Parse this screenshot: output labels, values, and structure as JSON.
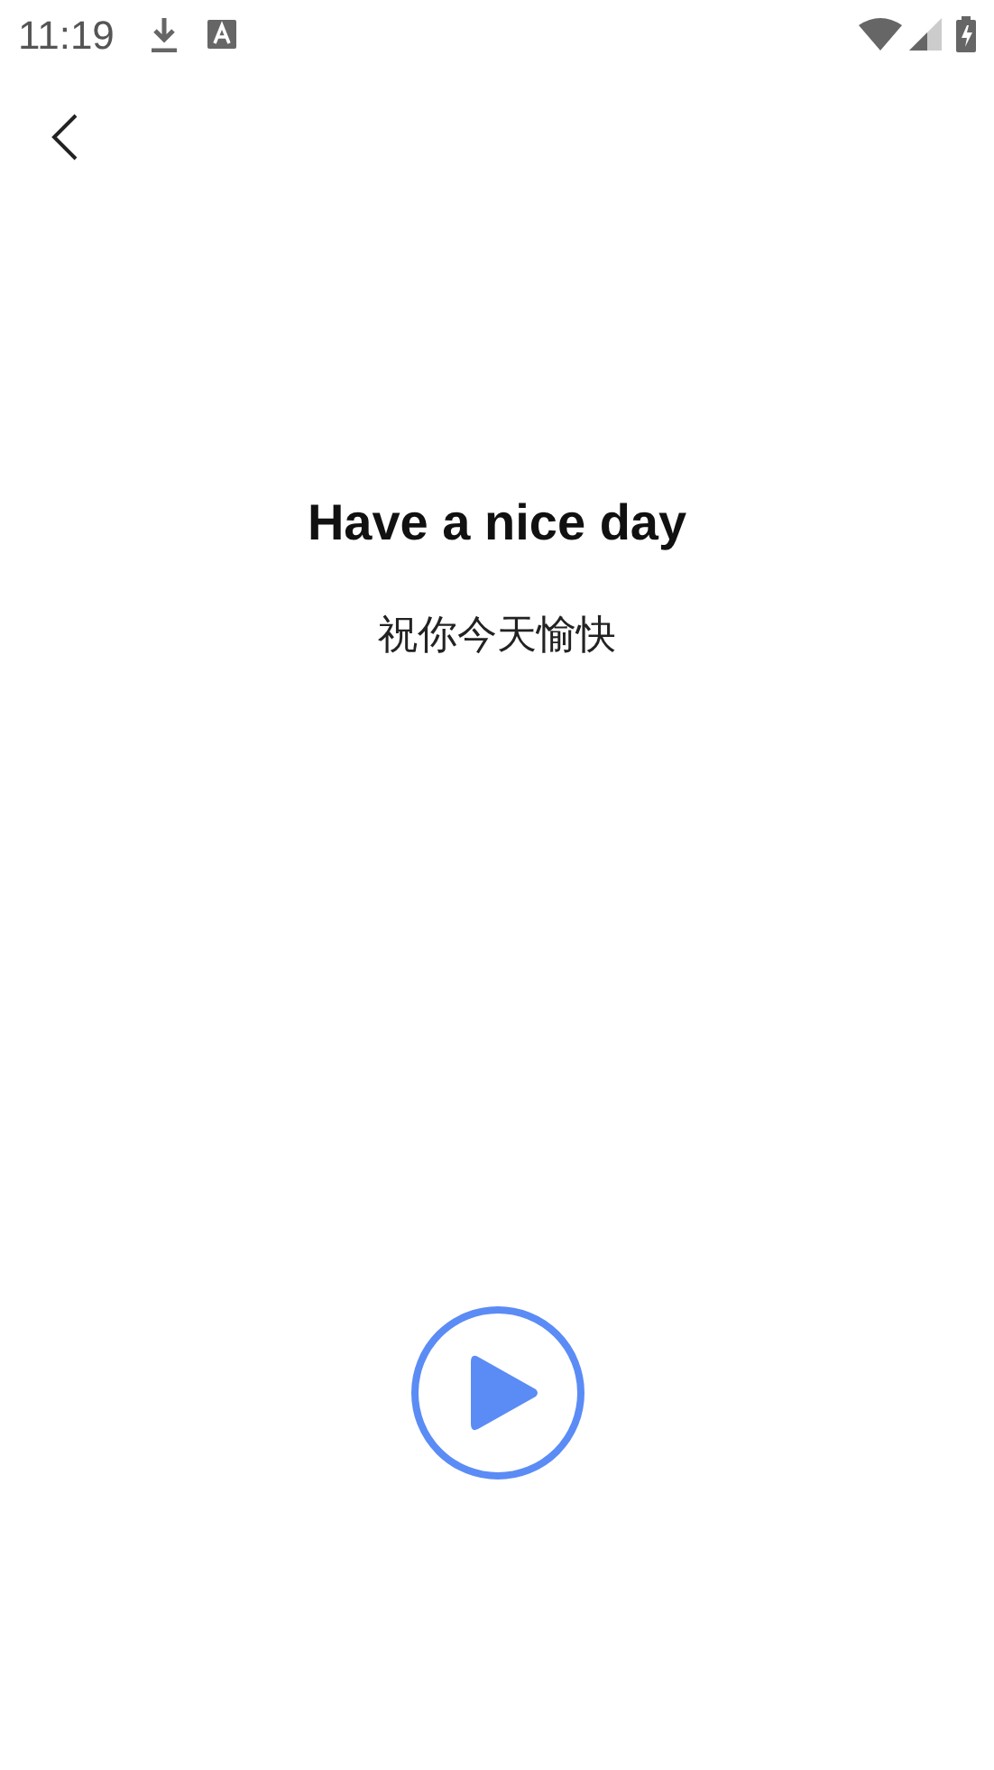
{
  "status_bar": {
    "time": "11:19"
  },
  "sentence": {
    "english": "Have a nice day",
    "chinese": "祝你今天愉快"
  },
  "player": {
    "playing": false
  }
}
